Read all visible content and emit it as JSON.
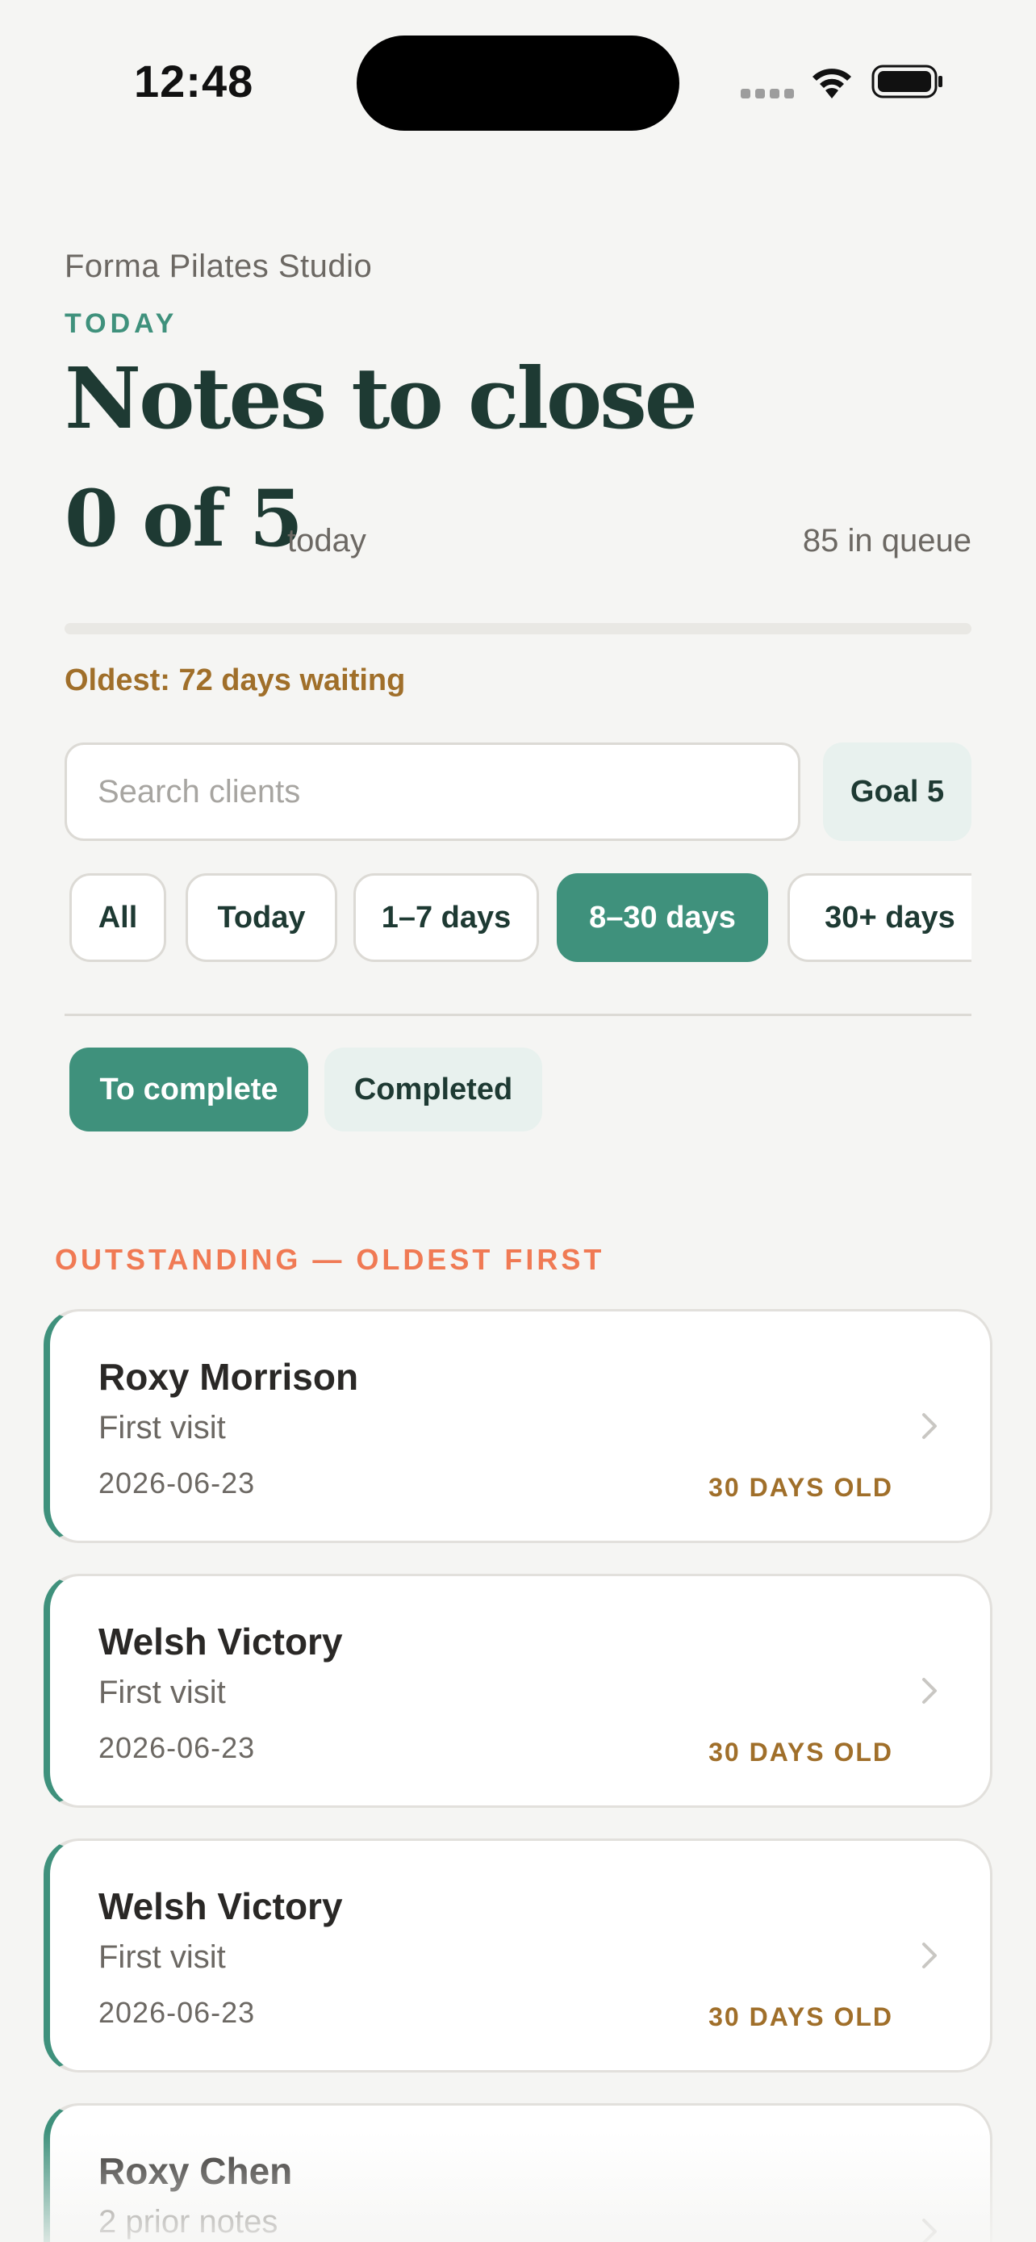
{
  "status_bar": {
    "time": "12:48",
    "icons": [
      "cellular-signal-icon",
      "wifi-icon",
      "battery-icon"
    ]
  },
  "header": {
    "studio_name": "Forma Pilates Studio",
    "eyebrow": "TODAY",
    "title": "Notes to close",
    "completed_count": "0 of 5",
    "completed_suffix": "today",
    "queue_text": "85 in queue",
    "progress_fraction": 0,
    "oldest_text": "Oldest: 72 days waiting"
  },
  "search": {
    "placeholder": "Search clients",
    "value": ""
  },
  "goal_label": "Goal 5",
  "filters": [
    {
      "label": "All",
      "active": false
    },
    {
      "label": "Today",
      "active": false
    },
    {
      "label": "1–7 days",
      "active": false
    },
    {
      "label": "8–30 days",
      "active": true
    },
    {
      "label": "30+ days",
      "active": false
    }
  ],
  "tabs": [
    {
      "label": "To complete",
      "active": true
    },
    {
      "label": "Completed",
      "active": false
    }
  ],
  "section_label": "OUTSTANDING — OLDEST FIRST",
  "notes": [
    {
      "name": "Roxy Morrison",
      "subtitle": "First visit",
      "date": "2026-06-23",
      "age": "30 DAYS OLD"
    },
    {
      "name": "Welsh Victory",
      "subtitle": "First visit",
      "date": "2026-06-23",
      "age": "30 DAYS OLD"
    },
    {
      "name": "Welsh Victory",
      "subtitle": "First visit",
      "date": "2026-06-23",
      "age": "30 DAYS OLD"
    },
    {
      "name": "Roxy Chen",
      "subtitle": "2 prior notes",
      "date": "",
      "age": ""
    }
  ],
  "colors": {
    "accent": "#3f917c",
    "accent_soft": "#e8f1ee",
    "heading": "#1e3a33",
    "warning": "#a06f2a",
    "section": "#f07a54",
    "background": "#f5f5f3"
  }
}
